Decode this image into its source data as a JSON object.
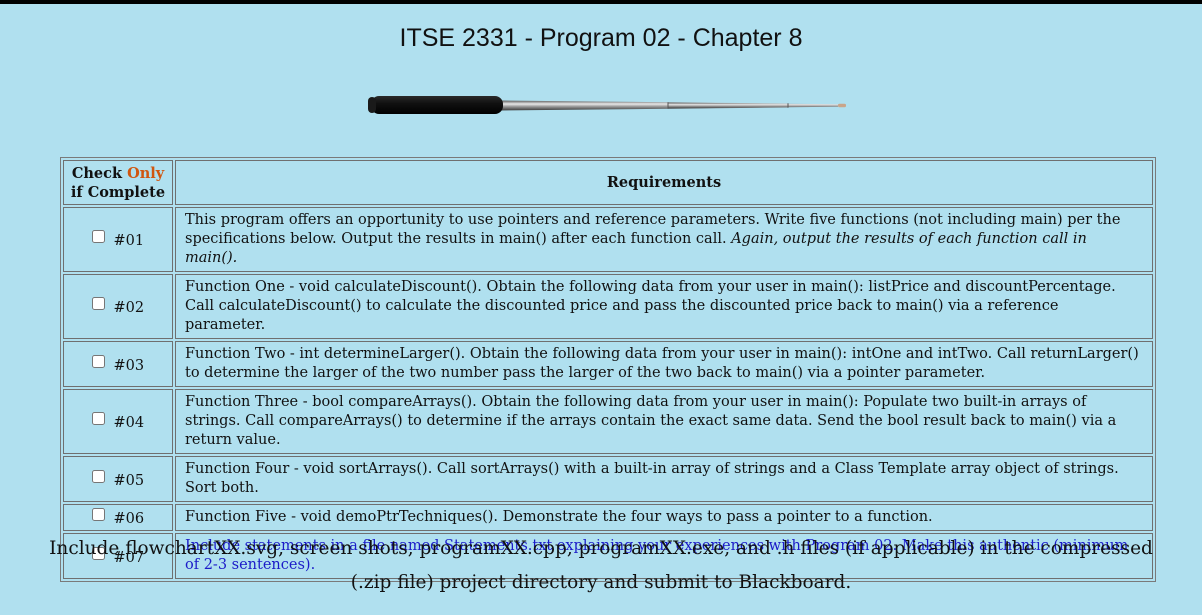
{
  "page": {
    "title": "ITSE 2331 - Program 02 - Chapter 8",
    "background_color": "#b0e0ef"
  },
  "graphic": {
    "name": "telescoping-pointer-stick"
  },
  "table": {
    "header": {
      "check_prefix": "Check",
      "check_only": "Only",
      "check_suffix": "if Complete",
      "requirements": "Requirements"
    },
    "rows": [
      {
        "id": "#01",
        "checked": false,
        "text_plain": "This program offers an opportunity to use pointers and reference parameters. Write five functions (not including main) per the specifications below. Output the results in main() after each function call.",
        "text_italic": "Again, output the results of each function call in main()."
      },
      {
        "id": "#02",
        "checked": false,
        "text": "Function One - void calculateDiscount(). Obtain the following data from your user in main(): listPrice and discountPercentage. Call calculateDiscount() to calculate the discounted price and pass the discounted price back to main() via a reference parameter."
      },
      {
        "id": "#03",
        "checked": false,
        "text": "Function Two - int determineLarger(). Obtain the following data from your user in main(): intOne and intTwo. Call returnLarger() to determine the larger of the two number pass the larger of the two back to main() via a pointer parameter."
      },
      {
        "id": "#04",
        "checked": false,
        "text": "Function Three - bool compareArrays(). Obtain the following data from your user in main(): Populate two built-in arrays of strings. Call compareArrays() to determine if the arrays contain the exact same data. Send the bool result back to main() via a return value."
      },
      {
        "id": "#05",
        "checked": false,
        "text": "Function Four - void sortArrays(). Call sortArrays() with a built-in array of strings and a Class Template array object of strings. Sort both."
      },
      {
        "id": "#06",
        "checked": false,
        "text": "Function Five - void demoPtrTechniques(). Demonstrate the four ways to pass a pointer to a function."
      },
      {
        "id": "#07",
        "checked": false,
        "text": "Include statements in a file named Statements.txt explaining your experiences with Program 02. Make this authentic (minimum of 2-3 sentences).",
        "color": "#1b1bc8"
      }
    ]
  },
  "footer": {
    "text": "Include flowchartXX.svg, screen shots, programXX.cpp, programXX.exe, and .h files (if applicable) in the compressed (.zip file) project directory and submit to Blackboard."
  }
}
